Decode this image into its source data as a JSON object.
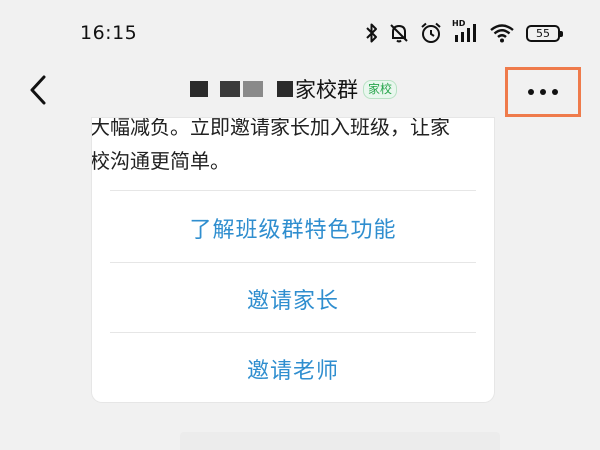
{
  "status_bar": {
    "time": "16:15",
    "battery": "55",
    "hd_label": "HD",
    "icons": [
      "bluetooth-icon",
      "mute-bell-icon",
      "alarm-icon",
      "signal-icon",
      "wifi-icon",
      "battery-icon"
    ]
  },
  "nav": {
    "title": "家校群",
    "tag": "家校",
    "back_icon": "chevron-left-icon",
    "more_icon": "more-dots-icon",
    "highlight_color": "#ef7b4b"
  },
  "card": {
    "lines": [
      "大幅减负。立即邀请家长加入班级，让家",
      "校沟通更简单。"
    ],
    "actions": [
      {
        "label": "了解班级群特色功能"
      },
      {
        "label": "邀请家长"
      },
      {
        "label": "邀请老师"
      }
    ],
    "action_color": "#2f8ecf"
  }
}
